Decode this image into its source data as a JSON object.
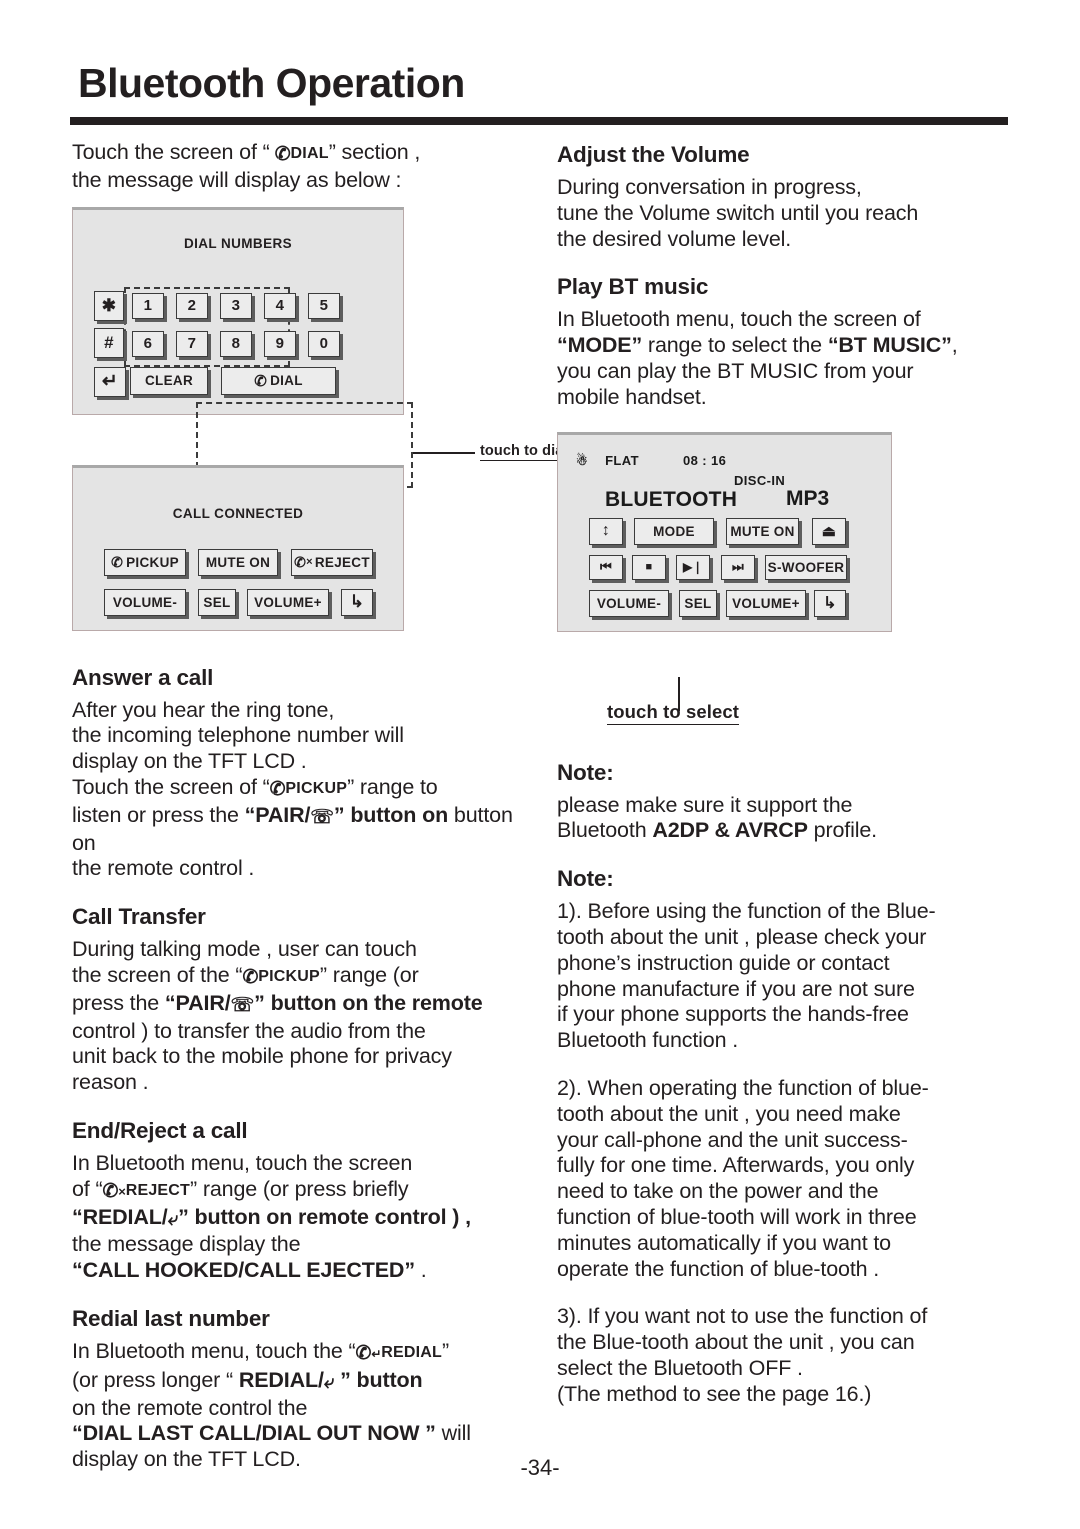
{
  "page": {
    "title": "Bluetooth Operation",
    "number": "-34-"
  },
  "left_column": {
    "intro": {
      "line1_pre": "Touch the screen of “",
      "chip": "DIAL",
      "line1_post": "” section ,",
      "line2": "the message will display as below :"
    },
    "dial_panel": {
      "title": "DIAL NUMBERS",
      "sym_keys": [
        "✱",
        "#"
      ],
      "return_key": "↵",
      "number_rows": [
        [
          "1",
          "2",
          "3",
          "4",
          "5"
        ],
        [
          "6",
          "7",
          "8",
          "9",
          "0"
        ]
      ],
      "clear_label": "CLEAR",
      "dial_label": "DIAL",
      "annotation": "touch to dial"
    },
    "call_panel": {
      "title": "CALL CONNECTED",
      "row1": [
        "PICKUP",
        "MUTE ON",
        "REJECT"
      ],
      "row2": [
        "VOLUME-",
        "SEL",
        "VOLUME+",
        "↳"
      ]
    },
    "answer_a_call": {
      "heading": "Answer a call",
      "l1": "After you hear the ring tone,",
      "l2": "the incoming telephone number will",
      "l3": "display on the TFT LCD .",
      "l4_pre": "Touch the screen of “",
      "l4_chip": "PICKUP",
      "l4_post": "” range to",
      "l5_pre": "listen or press the ",
      "l5_bold": "“PAIR/",
      "l5_post": "” button on",
      "l6": "the remote control ."
    },
    "call_transfer": {
      "heading": "Call Transfer",
      "l1": "During talking mode ,  user can touch",
      "l2_pre": "the screen of the “",
      "l2_chip": "PICKUP",
      "l2_post": "” range (or",
      "l3_pre": "press the ",
      "l3_bold": "“PAIR/",
      "l3_post": "” button on the remote",
      "l4": "control ) to transfer the audio from the",
      "l5": "unit back to the mobile phone for privacy",
      "l6": "reason ."
    },
    "end_reject": {
      "heading": "End/Reject a call",
      "l1": "In Bluetooth menu, touch the screen",
      "l2_pre": "of “",
      "l2_chip": "REJECT",
      "l2_post": "” range (or press briefly",
      "l3_bold": "“REDIAL/",
      "l3_post": "” button on remote control ) ,",
      "l4": "the message display the",
      "l5_bold": "“CALL HOOKED/CALL EJECTED”",
      "l5_post": " ."
    },
    "redial": {
      "heading": "Redial last number",
      "l1_pre": "In Bluetooth menu, touch the “",
      "l1_chip": "REDIAL",
      "l1_post": "”",
      "l2_pre": "(or press longer  “ ",
      "l2_bold": "REDIAL/",
      "l2_post": " ” button",
      "l3": "on the remote control the",
      "l4_bold": "“DIAL LAST CALL/DIAL OUT NOW ”",
      "l4_post": " will",
      "l5": "display on the TFT LCD."
    }
  },
  "right_column": {
    "adjust_volume": {
      "heading": "Adjust the Volume",
      "l1": "During conversation in progress,",
      "l2": "tune the Volume switch until you reach",
      "l3": "the desired volume level."
    },
    "play_bt_music": {
      "heading": "Play BT music",
      "l1": "In Bluetooth menu, touch the screen of",
      "l2_bold": "“MODE”",
      "l2_mid": " range to select the ",
      "l2_bold2": "“BT MUSIC”",
      "l2_post": ",",
      "l3": "you can play the BT MUSIC from your",
      "l4": "mobile handset."
    },
    "bt_panel": {
      "status_flat": "FLAT",
      "status_time": "08 : 16",
      "status_disc": "DISC-IN",
      "label_left": "BLUETOOTH",
      "label_right": "MP3",
      "row1": [
        "↕",
        "MODE",
        "MUTE ON",
        "⏏"
      ],
      "row2": [
        "⏮",
        "■",
        "▶❘",
        "⏭",
        "S-WOOFER"
      ],
      "row3": [
        "VOLUME-",
        "SEL",
        "VOLUME+",
        "↳"
      ],
      "annotation": "touch to select"
    },
    "note1": {
      "heading": "Note:",
      "l1": "please make sure it support the",
      "l2_pre": "Bluetooth ",
      "l2_bold": "A2DP & AVRCP",
      "l2_post": " profile."
    },
    "note2": {
      "heading": "Note:",
      "p1": [
        "1). Before using the function of the Blue-",
        "tooth about the unit , please check your",
        "phone’s instruction guide or contact",
        " phone manufacture if you are not sure",
        "if your phone supports the hands-free",
        "Bluetooth function ."
      ],
      "p2": [
        "2). When operating the function of blue-",
        "tooth about the unit , you need make",
        "your call-phone and the unit success-",
        "fully for one time. Afterwards, you only",
        "need to take on the power and the",
        "function of blue-tooth will work in three",
        "minutes automatically if you want to",
        "operate the function of blue-tooth ."
      ],
      "p3": [
        "3). If you want not to use the function of",
        "the Blue-tooth about the unit , you can",
        "select the Bluetooth OFF .",
        "(The method to see the page 16.)"
      ]
    }
  },
  "colors": {
    "ink": "#231f20",
    "panel_bg": "#e4e4e4",
    "key_bg": "#ececec",
    "key_border": "#3b3b3b"
  }
}
